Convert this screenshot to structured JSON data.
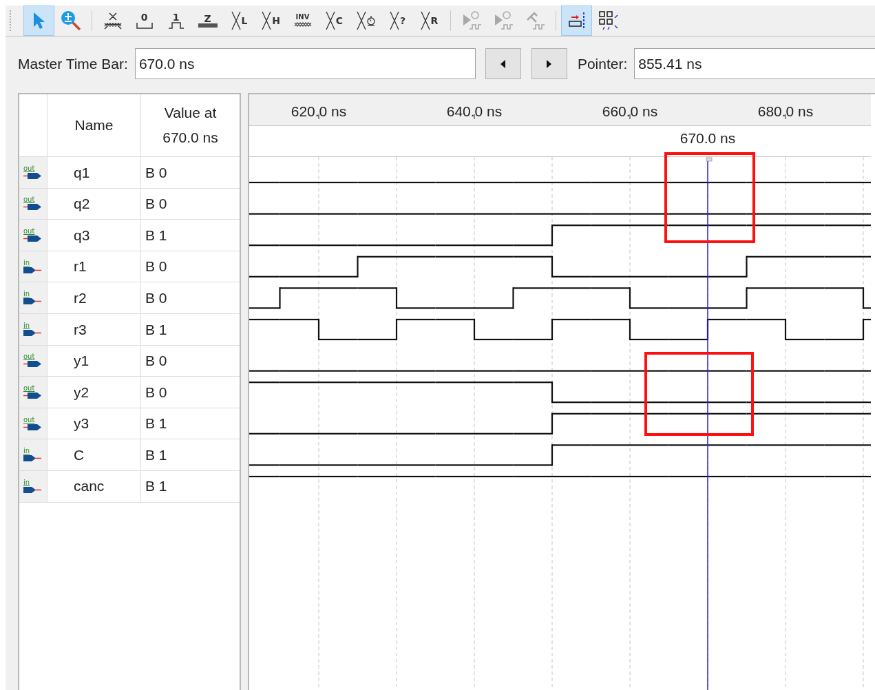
{
  "toolbar": [
    {
      "kind": "pointer",
      "selected": true,
      "disabled": false
    },
    {
      "kind": "zoom",
      "selected": false,
      "disabled": false
    },
    {
      "kind": "hatch",
      "selected": false,
      "disabled": false
    },
    {
      "kind": "low",
      "glyph": "0",
      "selected": false,
      "disabled": false
    },
    {
      "kind": "high",
      "glyph": "1",
      "selected": false,
      "disabled": false
    },
    {
      "kind": "bar",
      "glyph": "Z",
      "selected": false,
      "disabled": false
    },
    {
      "kind": "cross",
      "glyph": "L",
      "selected": false,
      "disabled": false
    },
    {
      "kind": "cross",
      "glyph": "H",
      "selected": false,
      "disabled": false
    },
    {
      "kind": "inv",
      "glyph": "INV",
      "selected": false,
      "disabled": false
    },
    {
      "kind": "cross",
      "glyph": "C",
      "selected": false,
      "disabled": false
    },
    {
      "kind": "clock",
      "selected": false,
      "disabled": false
    },
    {
      "kind": "cross",
      "glyph": "?",
      "selected": false,
      "disabled": false
    },
    {
      "kind": "cross",
      "glyph": "R",
      "selected": false,
      "disabled": false
    },
    {
      "kind": "sim_plug",
      "selected": false,
      "disabled": true
    },
    {
      "kind": "sim_timer",
      "selected": false,
      "disabled": true
    },
    {
      "kind": "sim_hammer",
      "selected": false,
      "disabled": true
    },
    {
      "kind": "snap",
      "selected": true,
      "disabled": false
    },
    {
      "kind": "grid",
      "selected": false,
      "disabled": false
    }
  ],
  "time_bar": {
    "label": "Master Time Bar:",
    "value": "670.0 ns",
    "pointer_label": "Pointer:",
    "pointer_value": "855.41 ns"
  },
  "columns": {
    "name": "Name",
    "value": "Value at 670.0 ns"
  },
  "timeline": {
    "ticks": [
      "620.0 ns",
      "640.0 ns",
      "660.0 ns",
      "680.0 ns"
    ],
    "cursor": "670.0 ns"
  },
  "signals": [
    {
      "kind": "output",
      "icon_label": "out",
      "name": "q1",
      "value": "B 0",
      "wave": [
        false,
        false,
        false,
        false,
        false,
        false,
        false,
        false,
        false,
        false,
        false,
        false,
        false,
        false,
        false,
        false,
        false
      ]
    },
    {
      "kind": "output",
      "icon_label": "out",
      "name": "q2",
      "value": "B 0",
      "wave": [
        false,
        false,
        false,
        false,
        false,
        false,
        false,
        false,
        false,
        false,
        false,
        false,
        false,
        false,
        false,
        false,
        false
      ]
    },
    {
      "kind": "output",
      "icon_label": "out",
      "name": "q3",
      "value": "B 1",
      "wave": [
        false,
        false,
        false,
        false,
        false,
        false,
        false,
        false,
        true,
        true,
        true,
        true,
        true,
        true,
        true,
        true,
        true
      ]
    },
    {
      "kind": "input",
      "icon_label": "in",
      "name": "r1",
      "value": "B 0",
      "wave": [
        false,
        false,
        false,
        true,
        true,
        true,
        true,
        true,
        false,
        false,
        false,
        false,
        false,
        true,
        true,
        true,
        true
      ]
    },
    {
      "kind": "input",
      "icon_label": "in",
      "name": "r2",
      "value": "B 0",
      "wave": [
        false,
        true,
        true,
        true,
        false,
        false,
        false,
        true,
        true,
        true,
        false,
        false,
        false,
        true,
        true,
        true,
        false
      ]
    },
    {
      "kind": "input",
      "icon_label": "in",
      "name": "r3",
      "value": "B 1",
      "wave": [
        true,
        true,
        false,
        false,
        true,
        true,
        false,
        false,
        true,
        true,
        false,
        false,
        true,
        true,
        false,
        false,
        true
      ]
    },
    {
      "kind": "output",
      "icon_label": "out",
      "name": "y1",
      "value": "B 0",
      "wave": [
        false,
        false,
        false,
        false,
        false,
        false,
        false,
        false,
        false,
        false,
        false,
        false,
        false,
        false,
        false,
        false,
        false
      ]
    },
    {
      "kind": "output",
      "icon_label": "out",
      "name": "y2",
      "value": "B 0",
      "wave": [
        true,
        true,
        true,
        true,
        true,
        true,
        true,
        true,
        false,
        false,
        false,
        false,
        false,
        false,
        false,
        false,
        false
      ]
    },
    {
      "kind": "output",
      "icon_label": "out",
      "name": "y3",
      "value": "B 1",
      "wave": [
        false,
        false,
        false,
        false,
        false,
        false,
        false,
        false,
        true,
        true,
        true,
        true,
        true,
        true,
        true,
        true,
        true
      ]
    },
    {
      "kind": "input",
      "icon_label": "in",
      "name": "C",
      "value": "B 1",
      "wave": [
        false,
        false,
        false,
        false,
        false,
        false,
        false,
        false,
        true,
        true,
        true,
        true,
        true,
        true,
        true,
        true,
        true
      ]
    },
    {
      "kind": "input",
      "icon_label": "in",
      "name": "canc",
      "value": "B 1",
      "wave": [
        true,
        true,
        true,
        true,
        true,
        true,
        true,
        true,
        true,
        true,
        true,
        true,
        true,
        true,
        true,
        true,
        true
      ]
    }
  ]
}
